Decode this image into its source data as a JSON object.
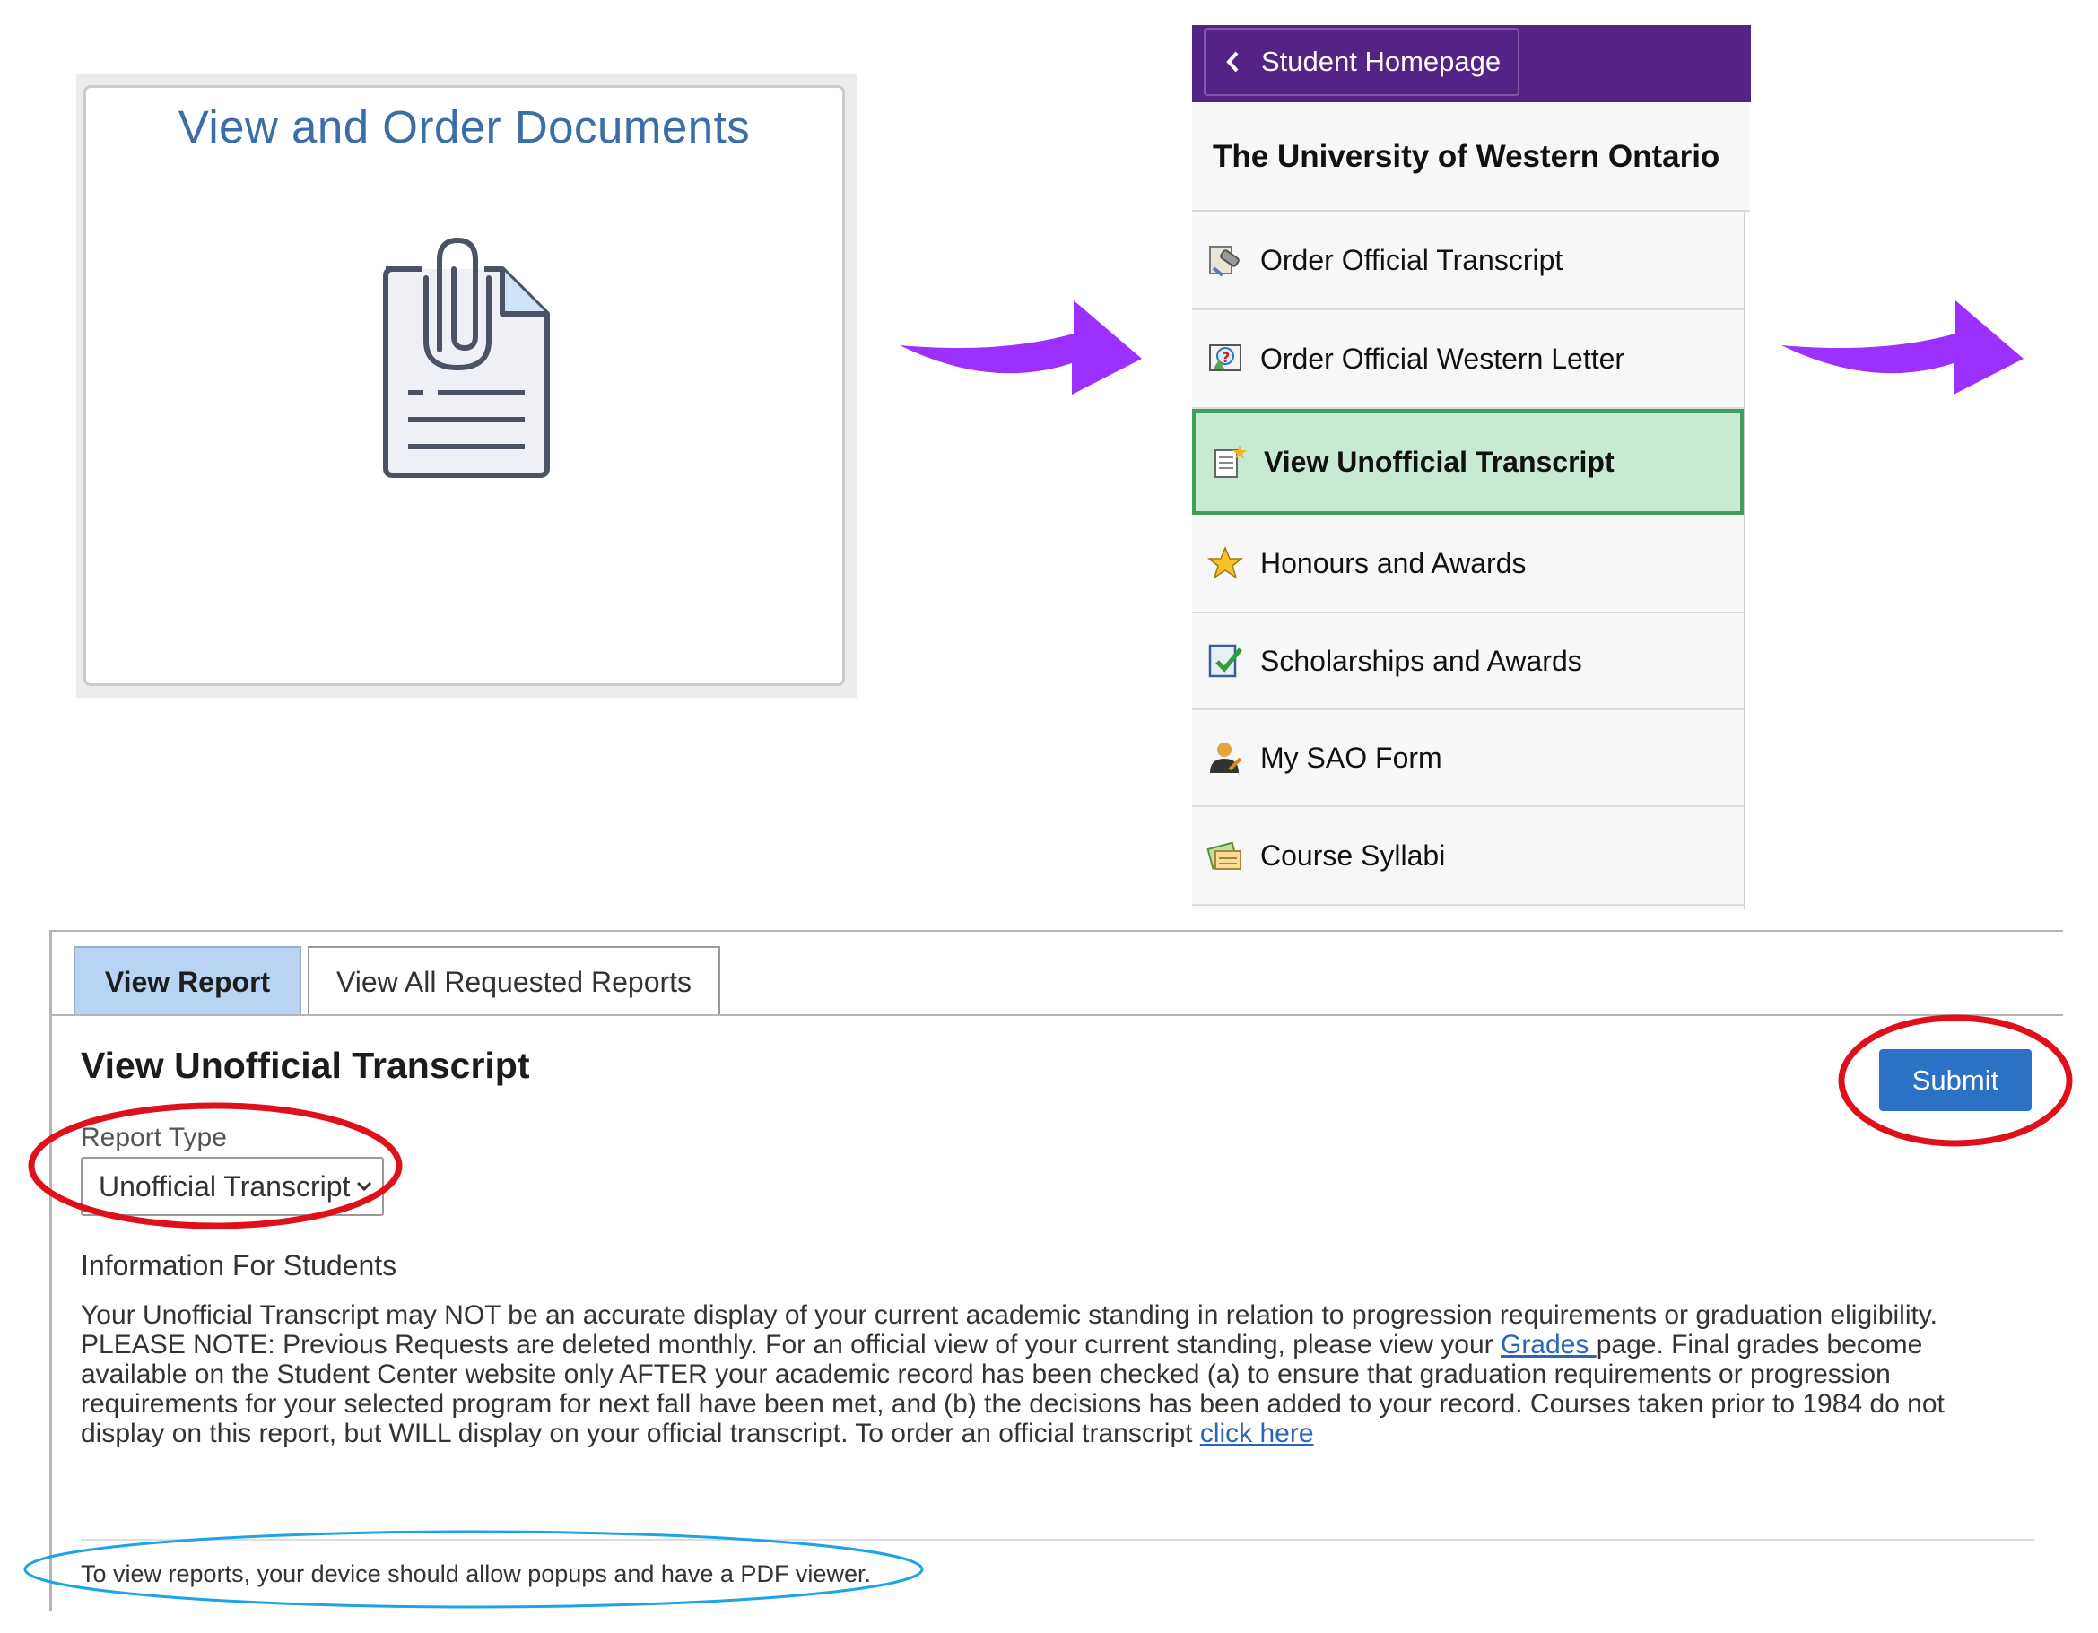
{
  "tile": {
    "title": "View and Order Documents",
    "icon": "document-attachment-icon"
  },
  "arrows": {
    "color": "#9b30ff",
    "count": 2
  },
  "menu": {
    "header_color": "#532486",
    "back_label": "Student Homepage",
    "institution": "The University of Western Ontario",
    "items": [
      {
        "label": "Order Official Transcript",
        "icon": "transcript-order-icon",
        "active": false
      },
      {
        "label": "Order Official Western Letter",
        "icon": "letter-question-icon",
        "active": false
      },
      {
        "label": "View Unofficial Transcript",
        "icon": "new-document-icon",
        "active": true
      },
      {
        "label": "Honours and Awards",
        "icon": "star-icon",
        "active": false
      },
      {
        "label": "Scholarships and Awards",
        "icon": "checklist-icon",
        "active": false
      },
      {
        "label": "My SAO Form",
        "icon": "person-edit-icon",
        "active": false
      },
      {
        "label": "Course Syllabi",
        "icon": "syllabus-icon",
        "active": false
      }
    ]
  },
  "report": {
    "tabs": [
      {
        "label": "View Report",
        "active": true
      },
      {
        "label": "View All Requested Reports",
        "active": false
      }
    ],
    "heading": "View Unofficial Transcript",
    "submit_label": "Submit",
    "report_type_label": "Report Type",
    "report_type_value": "Unofficial Transcript",
    "info_heading": "Information For Students",
    "info_text_before_grades": "Your Unofficial Transcript may NOT be an accurate display of your current academic standing in relation to progression requirements or graduation eligibility. PLEASE NOTE: Previous Requests are deleted monthly. For an official view of your current standing, please view your ",
    "grades_link": "Grades ",
    "info_text_after_grades": "page. Final grades become available on the Student Center website only AFTER your academic record has been checked (a) to ensure that graduation requirements or progression requirements for your selected program for next fall have been met, and (b) the decisions has been added to your record. Courses taken prior to 1984 do not display on this report, but WILL display on your official transcript. To order an official transcript ",
    "click_here_link": "click here",
    "popup_note": "To view reports, your device should allow popups and have a PDF viewer."
  },
  "colors": {
    "highlight_red": "#e0101a",
    "highlight_blue": "#1ca3e8",
    "submit_blue": "#2b72c6",
    "active_menu_green": "#c8ead3"
  }
}
